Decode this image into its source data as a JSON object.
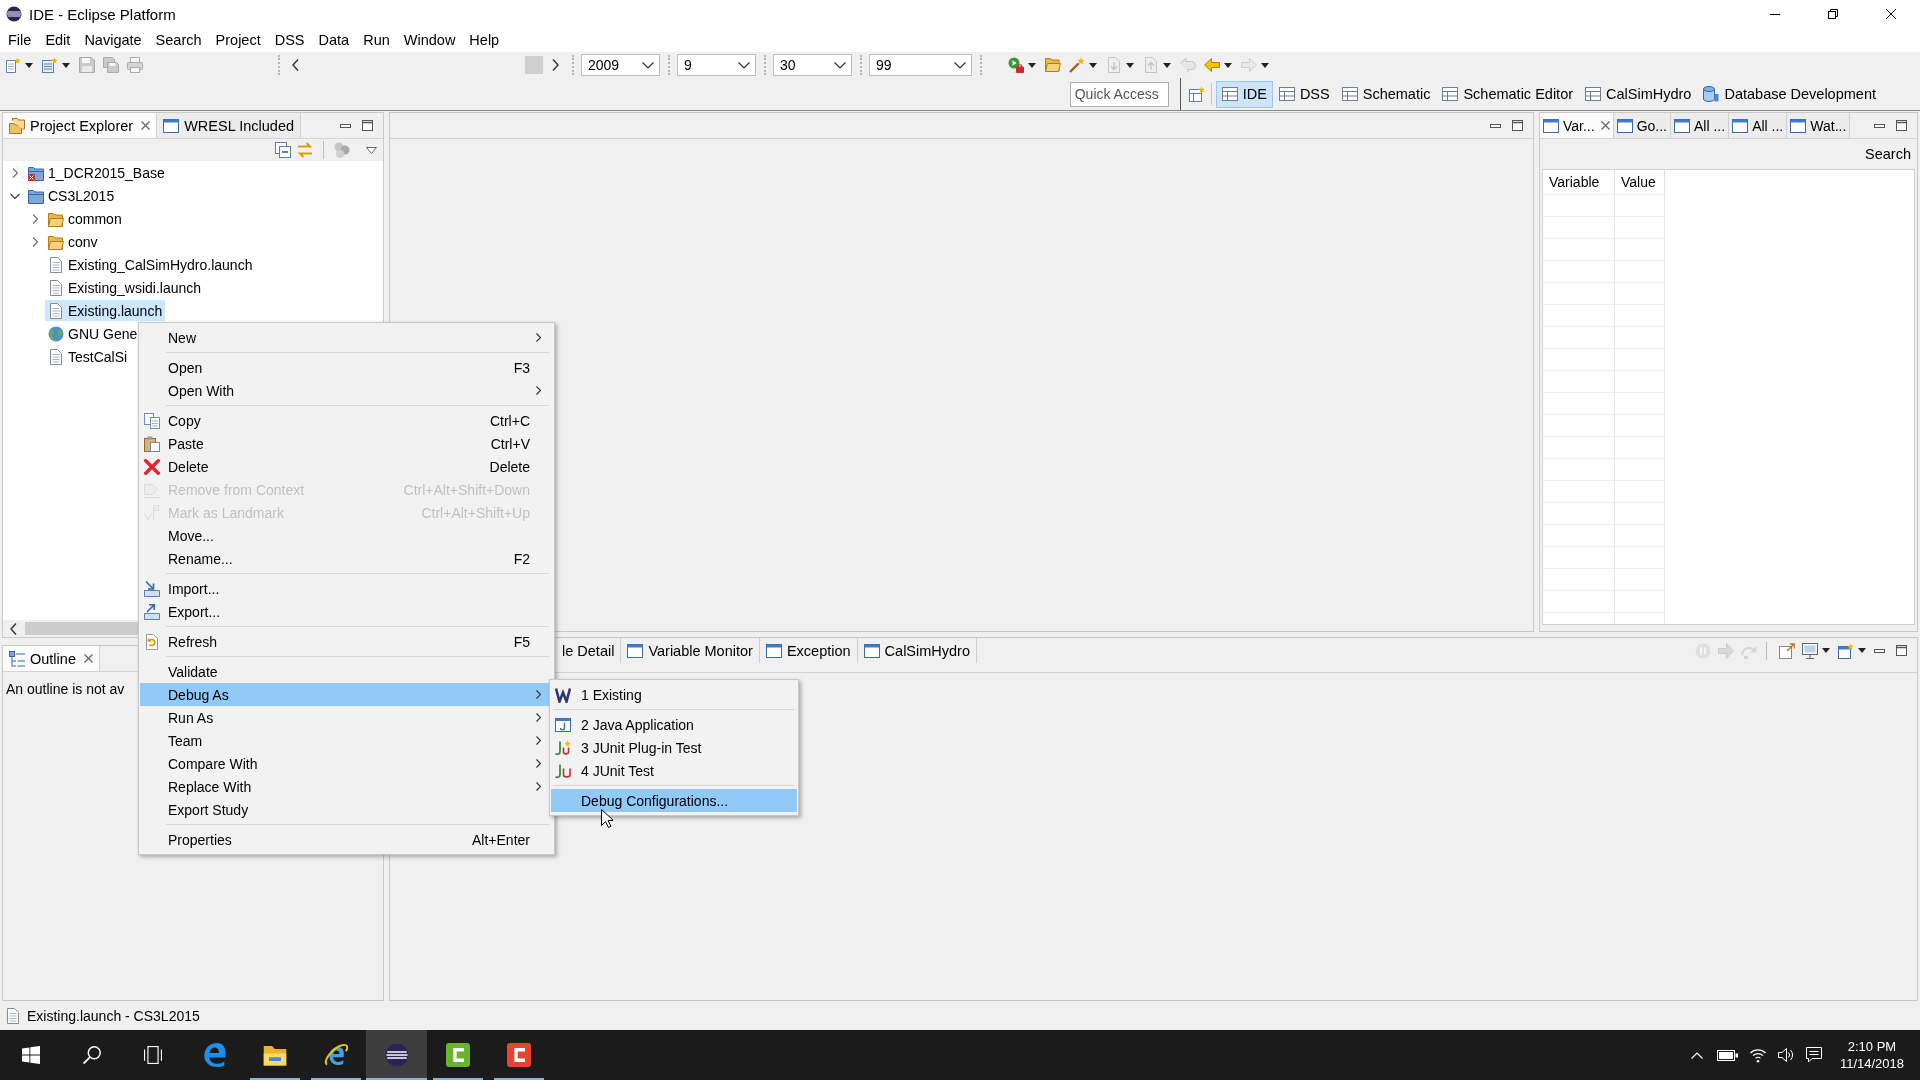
{
  "window": {
    "title": "IDE - Eclipse Platform"
  },
  "menu_bar": [
    "File",
    "Edit",
    "Navigate",
    "Search",
    "Project",
    "DSS",
    "Data",
    "Run",
    "Window",
    "Help"
  ],
  "toolbar": {
    "left_buttons": [
      {
        "dropdown": true,
        "disabled": false
      },
      {
        "dropdown": true,
        "disabled": false
      },
      {
        "dropdown": false,
        "disabled": true
      },
      {
        "dropdown": false,
        "disabled": true
      },
      {
        "dropdown": false,
        "disabled": true
      }
    ],
    "combos": [
      {
        "value": "2009"
      },
      {
        "value": "9"
      },
      {
        "value": "30"
      },
      {
        "value": "99"
      }
    ],
    "right_buttons": [
      {
        "dropdown": true,
        "disabled": false
      },
      {
        "dropdown": false,
        "disabled": false
      },
      {
        "dropdown": true,
        "disabled": false
      },
      {
        "dropdown": true,
        "disabled": true
      },
      {
        "dropdown": true,
        "disabled": true
      },
      {
        "dropdown": false,
        "disabled": true
      },
      {
        "dropdown": true,
        "disabled": false
      },
      {
        "dropdown": true,
        "disabled": true
      }
    ]
  },
  "perspective_bar": {
    "quick_access": {
      "placeholder": "Quick Access"
    },
    "perspectives": [
      {
        "label": "IDE",
        "kind": "table",
        "selected": true
      },
      {
        "label": "DSS",
        "kind": "table",
        "selected": false
      },
      {
        "label": "Schematic",
        "kind": "table",
        "selected": false
      },
      {
        "label": "Schematic Editor",
        "kind": "table",
        "selected": false
      },
      {
        "label": "CalSimHydro",
        "kind": "table",
        "selected": false
      },
      {
        "label": "Database Development",
        "kind": "database",
        "selected": false
      }
    ]
  },
  "project_explorer": {
    "tabs": [
      {
        "label": "Project Explorer",
        "selected": true
      },
      {
        "label": "WRESL Included",
        "selected": false
      }
    ],
    "tree": [
      {
        "label": "1_DCR2015_Base",
        "kind": "project",
        "expanded": false,
        "error": true,
        "selected": false
      },
      {
        "label": "CS3L2015",
        "kind": "project",
        "expanded": true,
        "error": false,
        "selected": false,
        "children": [
          {
            "label": "common",
            "kind": "folder",
            "expanded": false,
            "selected": false
          },
          {
            "label": "conv",
            "kind": "folder",
            "expanded": false,
            "selected": false
          },
          {
            "label": "Existing_CalSimHydro.launch",
            "kind": "file",
            "selected": false
          },
          {
            "label": "Existing_wsidi.launch",
            "kind": "file",
            "selected": false
          },
          {
            "label": "Existing.launch",
            "kind": "file",
            "selected": true
          },
          {
            "label": "GNU Gene",
            "kind": "web",
            "selected": false
          },
          {
            "label": "TestCalSi",
            "kind": "file",
            "selected": false
          }
        ]
      }
    ]
  },
  "outline": {
    "tabs": [
      {
        "label": "Outline",
        "selected": true
      }
    ],
    "message": "An outline is not av"
  },
  "right_panel": {
    "tabs": [
      {
        "label": "Var...",
        "selected": true
      },
      {
        "label": "Go...",
        "selected": false
      },
      {
        "label": "All ...",
        "selected": false
      },
      {
        "label": "All ...",
        "selected": false
      },
      {
        "label": "Wat...",
        "selected": false
      }
    ],
    "search_label": "Search",
    "table": {
      "columns": [
        "Variable",
        "Value"
      ]
    }
  },
  "bottom_panel": {
    "tabs": [
      {
        "label": "le Detail",
        "selected": false
      },
      {
        "label": "Variable Monitor",
        "selected": false
      },
      {
        "label": "Exception",
        "selected": false
      },
      {
        "label": "CalSimHydro",
        "selected": false
      }
    ],
    "toolbar": [
      {
        "dropdown": false,
        "disabled": true
      },
      {
        "dropdown": false,
        "disabled": true
      },
      {
        "dropdown": false,
        "disabled": true
      },
      {
        "dropdown": false,
        "disabled": false
      },
      {
        "dropdown": true,
        "disabled": false
      },
      {
        "dropdown": true,
        "disabled": false
      }
    ]
  },
  "context_menu": {
    "items": [
      {
        "kind": "item",
        "label": "New",
        "submenu": true,
        "disabled": false,
        "selected": false
      },
      {
        "kind": "separator"
      },
      {
        "kind": "item",
        "label": "Open",
        "shortcut": "F3",
        "submenu": false,
        "disabled": false,
        "selected": false
      },
      {
        "kind": "item",
        "label": "Open With",
        "submenu": true,
        "disabled": false,
        "selected": false
      },
      {
        "kind": "separator"
      },
      {
        "kind": "item",
        "label": "Copy",
        "shortcut": "Ctrl+C",
        "submenu": false,
        "disabled": false,
        "selected": false
      },
      {
        "kind": "item",
        "label": "Paste",
        "shortcut": "Ctrl+V",
        "submenu": false,
        "disabled": false,
        "selected": false
      },
      {
        "kind": "item",
        "label": "Delete",
        "shortcut": "Delete",
        "submenu": false,
        "disabled": false,
        "selected": false
      },
      {
        "kind": "item",
        "label": "Remove from Context",
        "shortcut": "Ctrl+Alt+Shift+Down",
        "submenu": false,
        "disabled": true,
        "selected": false
      },
      {
        "kind": "item",
        "label": "Mark as Landmark",
        "shortcut": "Ctrl+Alt+Shift+Up",
        "submenu": false,
        "disabled": true,
        "selected": false
      },
      {
        "kind": "item",
        "label": "Move...",
        "submenu": false,
        "disabled": false,
        "selected": false
      },
      {
        "kind": "item",
        "label": "Rename...",
        "shortcut": "F2",
        "submenu": false,
        "disabled": false,
        "selected": false
      },
      {
        "kind": "separator"
      },
      {
        "kind": "item",
        "label": "Import...",
        "submenu": false,
        "disabled": false,
        "selected": false
      },
      {
        "kind": "item",
        "label": "Export...",
        "submenu": false,
        "disabled": false,
        "selected": false
      },
      {
        "kind": "separator"
      },
      {
        "kind": "item",
        "label": "Refresh",
        "shortcut": "F5",
        "submenu": false,
        "disabled": false,
        "selected": false
      },
      {
        "kind": "separator"
      },
      {
        "kind": "item",
        "label": "Validate",
        "submenu": false,
        "disabled": false,
        "selected": false
      },
      {
        "kind": "item",
        "label": "Debug As",
        "submenu": true,
        "disabled": false,
        "selected": true
      },
      {
        "kind": "item",
        "label": "Run As",
        "submenu": true,
        "disabled": false,
        "selected": false
      },
      {
        "kind": "item",
        "label": "Team",
        "submenu": true,
        "disabled": false,
        "selected": false
      },
      {
        "kind": "item",
        "label": "Compare With",
        "submenu": true,
        "disabled": false,
        "selected": false
      },
      {
        "kind": "item",
        "label": "Replace With",
        "submenu": true,
        "disabled": false,
        "selected": false
      },
      {
        "kind": "item",
        "label": "Export Study",
        "submenu": false,
        "disabled": false,
        "selected": false
      },
      {
        "kind": "separator"
      },
      {
        "kind": "item",
        "label": "Properties",
        "shortcut": "Alt+Enter",
        "submenu": false,
        "disabled": false,
        "selected": false
      }
    ]
  },
  "submenu": {
    "items": [
      {
        "kind": "item",
        "label": "1 Existing",
        "selected": false
      },
      {
        "kind": "separator"
      },
      {
        "kind": "item",
        "label": "2 Java Application",
        "selected": false
      },
      {
        "kind": "item",
        "label": "3 JUnit Plug-in Test",
        "selected": false
      },
      {
        "kind": "item",
        "label": "4 JUnit Test",
        "selected": false
      },
      {
        "kind": "separator"
      },
      {
        "kind": "item",
        "label": "Debug Configurations...",
        "selected": true
      }
    ]
  },
  "status_bar": {
    "text": "Existing.launch - CS3L2015"
  },
  "taskbar": {
    "apps": [
      {
        "running": false,
        "selected": false
      },
      {
        "running": true,
        "selected": false
      },
      {
        "running": true,
        "selected": false
      },
      {
        "running": true,
        "selected": true
      },
      {
        "running": true,
        "selected": false
      },
      {
        "running": true,
        "selected": false
      }
    ],
    "tray": {
      "time": "2:10 PM",
      "date": "11/14/2018"
    }
  }
}
